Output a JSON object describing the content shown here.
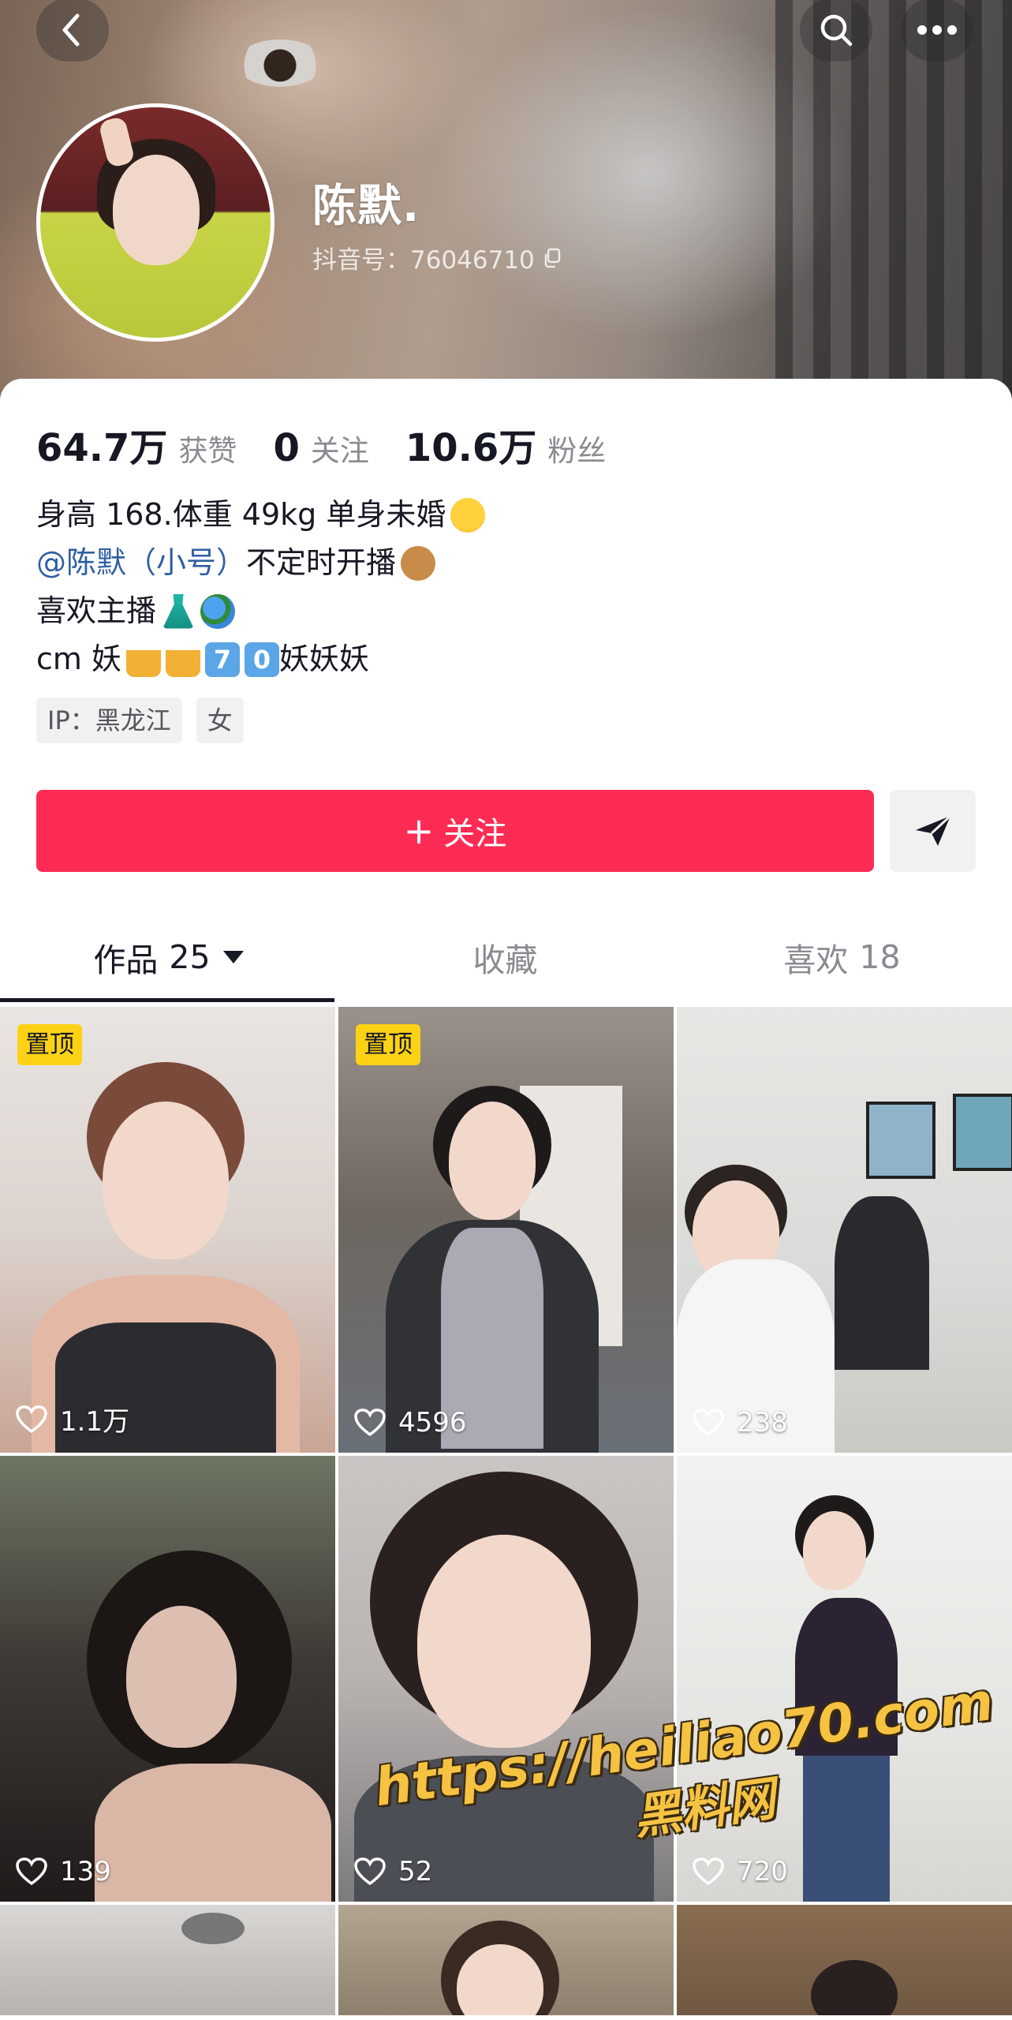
{
  "profile": {
    "name": "陈默.",
    "douyin_id": "抖音号：76046710"
  },
  "stats": [
    {
      "value": "64.7万",
      "label": "获赞"
    },
    {
      "value": "0",
      "label": "关注"
    },
    {
      "value": "10.6万",
      "label": "粉丝"
    }
  ],
  "bio": {
    "line1": "身高 168.体重 49kg 单身未婚",
    "line2_mention": "@陈默（小号）",
    "line2_rest": "不定时开播",
    "line3": "喜欢主播",
    "line4_a": "cm 妖",
    "line4_key1": "7",
    "line4_key2": "0",
    "line4_b": "妖妖妖"
  },
  "tags": [
    "IP：黑龙江",
    "女"
  ],
  "actions": {
    "follow_plus": "+",
    "follow_label": "关注"
  },
  "tabs": [
    {
      "label": "作品",
      "count": "25"
    },
    {
      "label": "收藏",
      "count": ""
    },
    {
      "label": "喜欢",
      "count": "18"
    }
  ],
  "videos": [
    {
      "pinned_label": "置顶",
      "likes": "1.1万"
    },
    {
      "pinned_label": "置顶",
      "likes": "4596"
    },
    {
      "pinned_label": "",
      "likes": "238"
    },
    {
      "pinned_label": "",
      "likes": "139"
    },
    {
      "pinned_label": "",
      "likes": "52"
    },
    {
      "pinned_label": "",
      "likes": "720"
    }
  ],
  "watermark": {
    "url": "https://heiliao70.com",
    "text": "黑料网"
  },
  "icons": {
    "back": "chevron-left-icon",
    "search": "search-icon",
    "more": "more-horizontal-icon",
    "copy": "copy-icon",
    "send": "send-icon",
    "heart": "heart-icon",
    "caret": "caret-down-icon"
  },
  "colors": {
    "accent": "#fe2c55",
    "pin_badge": "#fdd215",
    "mention": "#2f5fa3"
  }
}
